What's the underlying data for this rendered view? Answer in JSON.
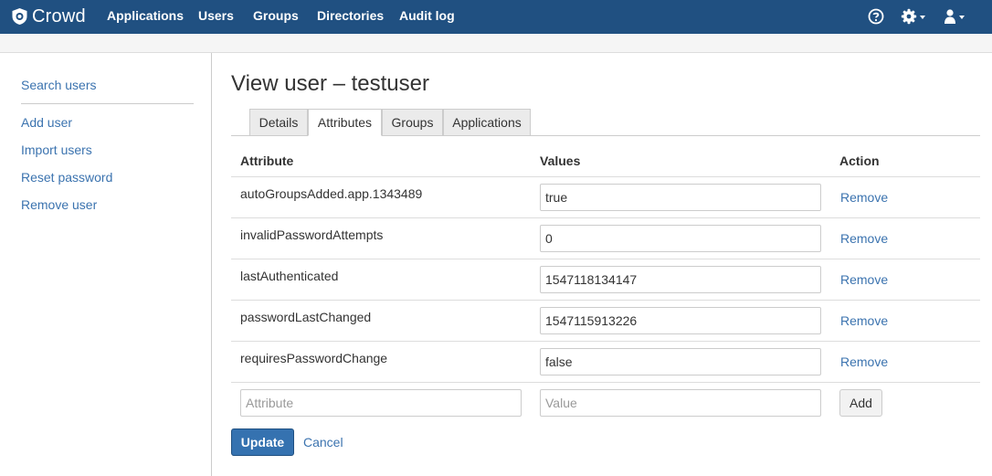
{
  "app": {
    "name": "Crowd"
  },
  "nav": {
    "items": [
      {
        "label": "Applications"
      },
      {
        "label": "Users"
      },
      {
        "label": "Groups"
      },
      {
        "label": "Directories"
      },
      {
        "label": "Audit log"
      }
    ]
  },
  "header_icons": {
    "help": "help-icon",
    "settings": "gear-icon",
    "user": "user-icon"
  },
  "sidebar": {
    "items": [
      {
        "label": "Search users"
      },
      {
        "label": "Add user"
      },
      {
        "label": "Import users"
      },
      {
        "label": "Reset password"
      },
      {
        "label": "Remove user"
      }
    ]
  },
  "page": {
    "title": "View user – testuser"
  },
  "tabs": [
    {
      "label": "Details",
      "active": false
    },
    {
      "label": "Attributes",
      "active": true
    },
    {
      "label": "Groups",
      "active": false
    },
    {
      "label": "Applications",
      "active": false
    }
  ],
  "table": {
    "headers": {
      "attribute": "Attribute",
      "values": "Values",
      "action": "Action"
    },
    "rows": [
      {
        "name": "autoGroupsAdded.app.1343489",
        "value": "true",
        "action": "Remove"
      },
      {
        "name": "invalidPasswordAttempts",
        "value": "0",
        "action": "Remove"
      },
      {
        "name": "lastAuthenticated",
        "value": "1547118134147",
        "action": "Remove"
      },
      {
        "name": "passwordLastChanged",
        "value": "1547115913226",
        "action": "Remove"
      },
      {
        "name": "requiresPasswordChange",
        "value": "false",
        "action": "Remove"
      }
    ],
    "new_row": {
      "attribute_placeholder": "Attribute",
      "value_placeholder": "Value",
      "add_label": "Add"
    }
  },
  "form": {
    "update_label": "Update",
    "cancel_label": "Cancel"
  },
  "colors": {
    "header_bg": "#205081",
    "link": "#3b73af",
    "primary_button": "#3572b0"
  }
}
